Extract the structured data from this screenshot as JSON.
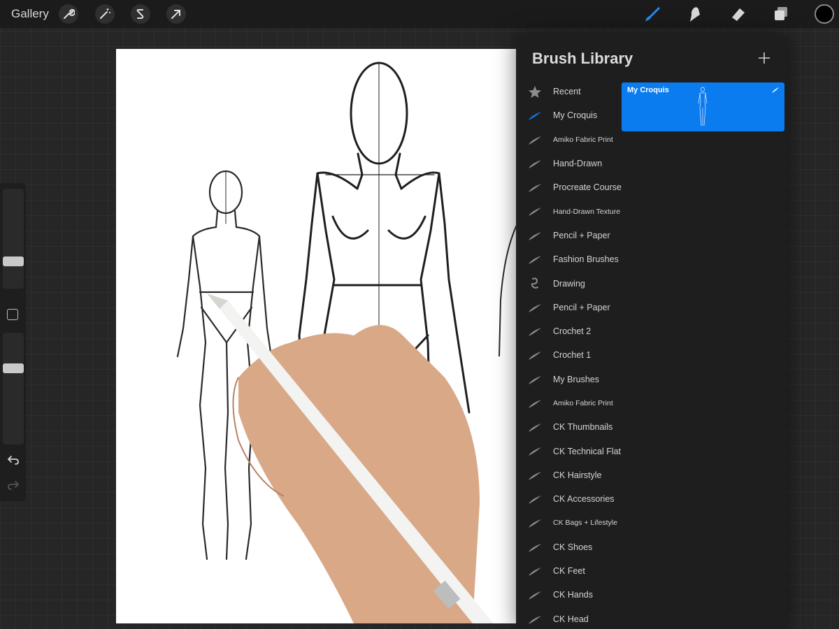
{
  "topbar": {
    "gallery_label": "Gallery",
    "left_tools": [
      "wrench-icon",
      "magic-wand-icon",
      "selection-s-icon",
      "transform-arrow-icon"
    ],
    "right_tools": [
      "brush-icon",
      "smudge-icon",
      "eraser-icon",
      "layers-icon"
    ],
    "active_tool": "brush",
    "current_color": "#000000",
    "accent_color": "#0b7cf0"
  },
  "sidebar": {
    "brush_size": 0.25,
    "opacity": 0.7
  },
  "panel": {
    "title": "Brush Library",
    "add_label": "+",
    "brush_sets": [
      {
        "label": "Recent",
        "icon": "star-icon",
        "small": false
      },
      {
        "label": "My Croquis",
        "icon": "brush-stroke-icon",
        "small": false,
        "selected": true
      },
      {
        "label": "Amiko Fabric Print",
        "icon": "brush-stroke-icon",
        "small": true
      },
      {
        "label": "Hand-Drawn",
        "icon": "brush-stroke-icon",
        "small": false
      },
      {
        "label": "Procreate Course",
        "icon": "brush-stroke-icon",
        "small": false
      },
      {
        "label": "Hand-Drawn Texture",
        "icon": "brush-stroke-icon",
        "small": true
      },
      {
        "label": "Pencil + Paper",
        "icon": "brush-stroke-icon",
        "small": false
      },
      {
        "label": "Fashion Brushes",
        "icon": "brush-stroke-icon",
        "small": false
      },
      {
        "label": "Drawing",
        "icon": "squiggle-icon",
        "small": false
      },
      {
        "label": "Pencil + Paper",
        "icon": "brush-stroke-icon",
        "small": false
      },
      {
        "label": "Crochet 2",
        "icon": "brush-stroke-icon",
        "small": false
      },
      {
        "label": "Crochet 1",
        "icon": "brush-stroke-icon",
        "small": false
      },
      {
        "label": "My Brushes",
        "icon": "brush-stroke-icon",
        "small": false
      },
      {
        "label": "Amiko Fabric Print",
        "icon": "brush-stroke-icon",
        "small": true
      },
      {
        "label": "CK Thumbnails",
        "icon": "brush-stroke-icon",
        "small": false
      },
      {
        "label": "CK Technical Flat",
        "icon": "brush-stroke-icon",
        "small": false
      },
      {
        "label": "CK Hairstyle",
        "icon": "brush-stroke-icon",
        "small": false
      },
      {
        "label": "CK Accessories",
        "icon": "brush-stroke-icon",
        "small": false
      },
      {
        "label": "CK Bags + Lifestyle",
        "icon": "brush-stroke-icon",
        "small": true
      },
      {
        "label": "CK Shoes",
        "icon": "brush-stroke-icon",
        "small": false
      },
      {
        "label": "CK Feet",
        "icon": "brush-stroke-icon",
        "small": false
      },
      {
        "label": "CK Hands",
        "icon": "brush-stroke-icon",
        "small": false
      },
      {
        "label": "CK Head",
        "icon": "brush-stroke-icon",
        "small": false
      }
    ],
    "selected_brush": {
      "name": "My Croquis"
    }
  }
}
